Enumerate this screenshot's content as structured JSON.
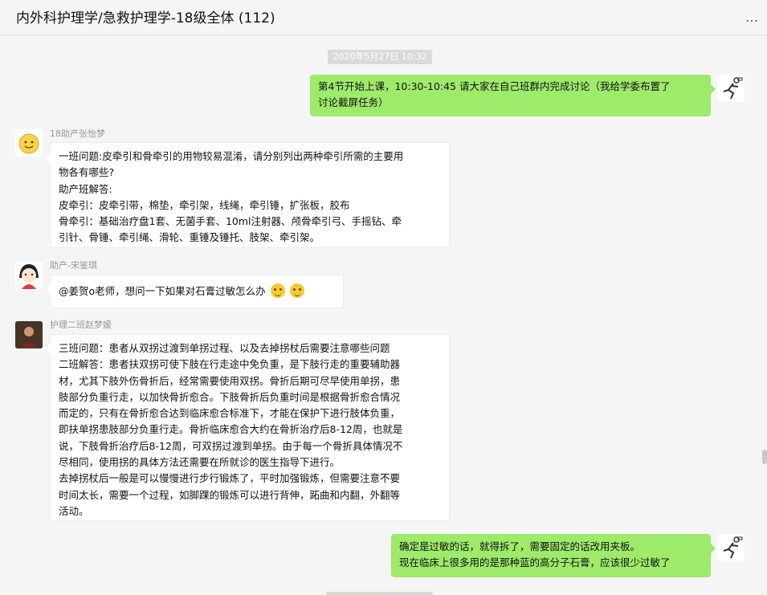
{
  "header": {
    "title": "内外科护理学/急救护理学-18级全体 (112)",
    "more_icon": "more-icon",
    "more_label": "…"
  },
  "timestamp": "2020年5月27日 10:32",
  "messages": [
    {
      "side": "right",
      "lines": [
        "第4节开始上课，10:30-10:45 请大家在自己班群内完成讨论（我给学委布置了",
        "讨论截屏任务）"
      ]
    },
    {
      "side": "left",
      "sender": "18助产张怡梦",
      "lines": [
        "一班问题:皮牵引和骨牵引的用物较易混淆，请分别列出两种牵引所需的主要用",
        "物各有哪些?",
        "助产班解答:",
        "皮牵引：皮牵引带，棉垫，牵引架，线绳，牵引锤，扩张板，胶布",
        "骨牵引：基础治疗盘1套、无菌手套、10ml注射器、颅骨牵引弓、手摇钻、牵",
        "引针、骨锤、牵引绳、滑轮、重锤及锤托、肢架、牵引架。"
      ]
    },
    {
      "side": "left",
      "sender": "助产-宋鉴琪",
      "lines": [
        "@姜贺o老师，想问一下如果对石膏过敏怎么办"
      ],
      "emojis": [
        "shy-face-emoji",
        "shy-face-emoji"
      ]
    },
    {
      "side": "left",
      "sender": "护理二班赵梦媛",
      "lines": [
        "三班问题：患者从双拐过渡到单拐过程、以及去掉拐杖后需要注意哪些问题",
        "二班解答：患者扶双拐可使下肢在行走途中免负重，是下肢行走的重要辅助器",
        "材，尤其下肢外伤骨折后，经常需要使用双拐。骨折后期可尽早使用单拐，患",
        "肢部分负重行走，以加快骨折愈合。下肢骨折后负重时间是根据骨折愈合情况",
        "而定的，只有在骨折愈合达到临床愈合标准下，才能在保护下进行肢体负重，",
        "即扶单拐患肢部分负重行走。骨折临床愈合大约在骨折治疗后8-12周，也就是",
        "说，下肢骨折治疗后8-12周，可双拐过渡到单拐。由于每一个骨折具体情况不",
        "尽相同，使用拐的具体方法还需要在所就诊的医生指导下进行。",
        "去掉拐杖后一般是可以慢慢进行步行锻炼了，平时加强锻炼，但需要注意不要",
        "时间太长，需要一个过程，如脚踝的锻炼可以进行背伸，跖曲和内翻，外翻等",
        "活动。"
      ]
    },
    {
      "side": "right",
      "lines": [
        "确定是过敏的话，就得拆了，需要固定的话改用夹板。",
        "现在临床上很多用的是那种蓝的高分子石膏，应该很少过敏了"
      ]
    }
  ],
  "colors": {
    "self_bubble": "#9eea6a",
    "other_bubble": "#ffffff",
    "background": "#f5f5f5"
  }
}
